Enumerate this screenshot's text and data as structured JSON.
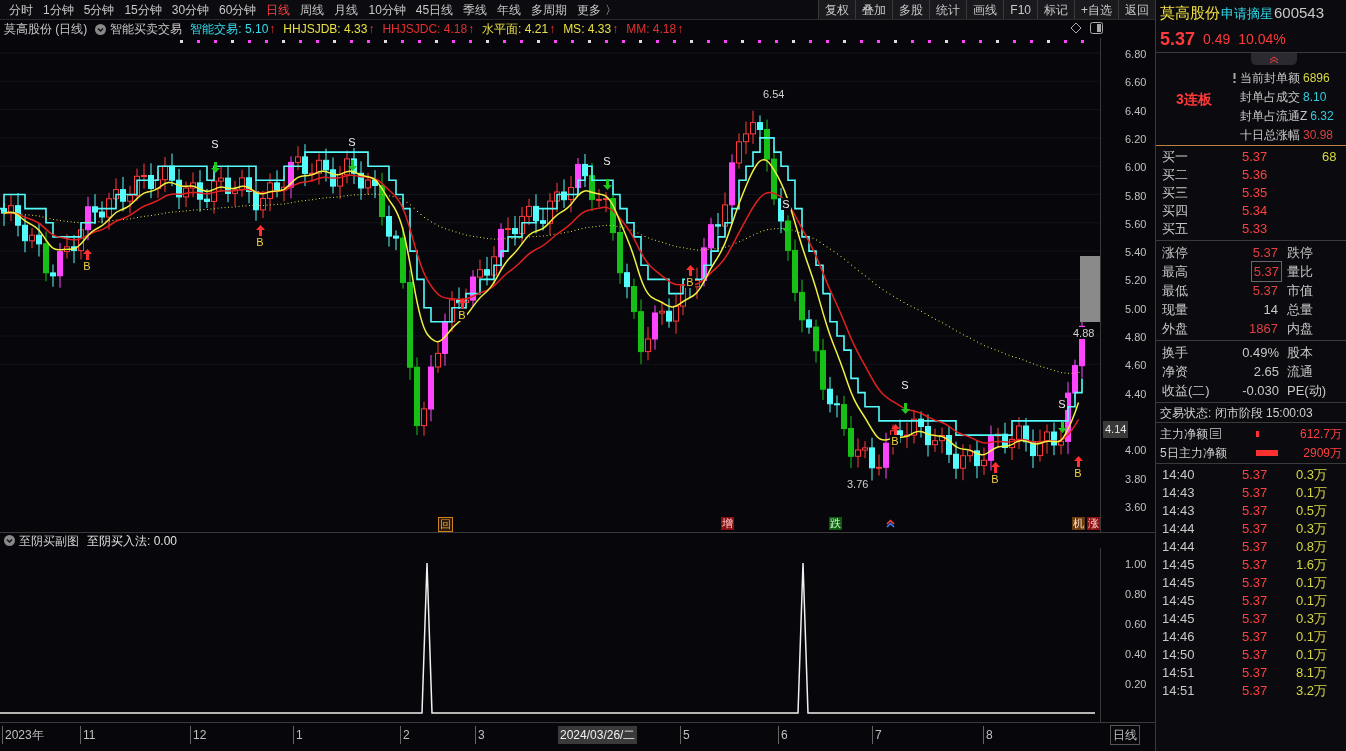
{
  "toolbar": {
    "tabs": [
      {
        "label": "分时",
        "selected": false
      },
      {
        "label": "1分钟",
        "selected": false
      },
      {
        "label": "5分钟",
        "selected": false
      },
      {
        "label": "15分钟",
        "selected": false
      },
      {
        "label": "30分钟",
        "selected": false
      },
      {
        "label": "60分钟",
        "selected": false
      },
      {
        "label": "日线",
        "selected": true
      },
      {
        "label": "周线",
        "selected": false
      },
      {
        "label": "月线",
        "selected": false
      },
      {
        "label": "10分钟",
        "selected": false
      },
      {
        "label": "45日线",
        "selected": false
      },
      {
        "label": "季线",
        "selected": false
      },
      {
        "label": "年线",
        "selected": false
      },
      {
        "label": "多周期",
        "selected": false
      },
      {
        "label": "更多 〉",
        "selected": false
      }
    ],
    "buttons": [
      "复权",
      "叠加",
      "多股",
      "统计",
      "画线",
      "F10",
      "标记",
      "+自选",
      "返回"
    ]
  },
  "legend": {
    "title": "莫高股份 (日线)",
    "indicator": "智能买卖交易",
    "values": [
      {
        "label": "智能交易: 5.10",
        "arrow": "↑",
        "color": "#33ddee"
      },
      {
        "label": "HHJSJDB: 4.33",
        "arrow": "↑",
        "color": "#e8e040"
      },
      {
        "label": "HHJSJDC: 4.18",
        "arrow": "↑",
        "color": "#e03030"
      },
      {
        "label": "水平面: 4.21",
        "arrow": "↑",
        "color": "#e8e040"
      },
      {
        "label": "MS: 4.33",
        "arrow": "↑",
        "color": "#e8e040"
      },
      {
        "label": "MM: 4.18",
        "arrow": "↑",
        "color": "#e03030"
      }
    ]
  },
  "main_chart": {
    "yticks": [
      "6.80",
      "6.60",
      "6.40",
      "6.20",
      "6.00",
      "5.80",
      "5.60",
      "5.40",
      "5.20",
      "5.00",
      "4.80",
      "4.60",
      "4.40",
      "4.00",
      "3.80",
      "3.60"
    ],
    "price_labels": [
      "6.54",
      "3.76",
      "4.88"
    ],
    "current_price": "4.14",
    "signals": [
      {
        "kind": "sell",
        "label": "S"
      },
      {
        "kind": "sell",
        "label": "S"
      },
      {
        "kind": "sell",
        "label": "S"
      },
      {
        "kind": "sell",
        "label": "S"
      },
      {
        "kind": "sell",
        "label": "S"
      },
      {
        "kind": "sell",
        "label": "S"
      },
      {
        "kind": "buy",
        "label": "B"
      },
      {
        "kind": "buy",
        "label": "B"
      },
      {
        "kind": "buy",
        "label": "B"
      },
      {
        "kind": "buy",
        "label": "B"
      },
      {
        "kind": "buy",
        "label": "B"
      },
      {
        "kind": "buy",
        "label": "B"
      },
      {
        "kind": "buy",
        "label": "B"
      }
    ],
    "events": [
      {
        "kind": "return",
        "label": "回"
      },
      {
        "kind": "add",
        "label": "增"
      },
      {
        "kind": "fall",
        "label": "跌"
      },
      {
        "kind": "concept",
        "label": "机"
      },
      {
        "kind": "rise",
        "label": "涨"
      }
    ]
  },
  "sub_chart": {
    "title": "至阴买副图",
    "value": "至阴买入法: 0.00",
    "yticks": [
      "1.00",
      "0.80",
      "0.60",
      "0.40",
      "0.20"
    ]
  },
  "x_axis": {
    "labels": [
      "2023年",
      "11",
      "12",
      "1",
      "2",
      "3",
      "5",
      "6",
      "7",
      "8"
    ],
    "cursor_date": "2024/03/26/二",
    "period": "日线"
  },
  "quote": {
    "name": "莫高股份",
    "tag": "申请摘星",
    "code": "600543",
    "price": "5.37",
    "change": "0.49",
    "percent": "10.04%",
    "streak": "3连板",
    "seal": [
      {
        "label": "当前封单额",
        "value": "6896",
        "color": "#d8d840",
        "has_icon": true
      },
      {
        "label": "封单占成交",
        "value": "8.10",
        "color": "#33ccdd",
        "has_icon": false
      },
      {
        "label": "封单占流通Z",
        "value": "6.32",
        "color": "#33ccdd",
        "has_icon": false
      },
      {
        "label": "十日总涨幅",
        "value": "30.98",
        "color": "#e04040",
        "has_icon": false
      }
    ],
    "bids": [
      {
        "label": "买一",
        "price": "5.37",
        "volume": "68"
      },
      {
        "label": "买二",
        "price": "5.36"
      },
      {
        "label": "买三",
        "price": "5.35"
      },
      {
        "label": "买四",
        "price": "5.34"
      },
      {
        "label": "买五",
        "price": "5.33"
      }
    ],
    "stats": [
      {
        "label": "涨停",
        "value": "5.37",
        "label2": "跌停",
        "color": "#e04040",
        "highlighted": false
      },
      {
        "label": "最高",
        "value": "5.37",
        "label2": "量比",
        "color": "#e04040",
        "highlighted": true
      },
      {
        "label": "最低",
        "value": "5.37",
        "label2": "市值",
        "color": "#e04040",
        "highlighted": false
      },
      {
        "label": "现量",
        "value": "14",
        "label2": "总量",
        "color": "#c8c8c8",
        "highlighted": false
      },
      {
        "label": "外盘",
        "value": "1867",
        "label2": "内盘",
        "color": "#e04040",
        "highlighted": false
      }
    ],
    "fundamentals": [
      {
        "label": "换手",
        "value": "0.49%",
        "label2": "股本"
      },
      {
        "label": "净资",
        "value": "2.65",
        "label2": "流通"
      },
      {
        "label": "收益(二)",
        "value": "-0.030",
        "label2": "PE(动)"
      }
    ],
    "status": "交易状态: 闭市阶段 15:00:03",
    "flows": [
      {
        "label": "主力净额",
        "value": "612.7万",
        "has_icon": true
      },
      {
        "label": "5日主力净额",
        "value": "2909万",
        "has_icon": false
      }
    ],
    "ticks": [
      {
        "time": "14:40",
        "price": "5.37",
        "volume": "0.3万"
      },
      {
        "time": "14:43",
        "price": "5.37",
        "volume": "0.1万"
      },
      {
        "time": "14:43",
        "price": "5.37",
        "volume": "0.5万"
      },
      {
        "time": "14:44",
        "price": "5.37",
        "volume": "0.3万"
      },
      {
        "time": "14:44",
        "price": "5.37",
        "volume": "0.8万"
      },
      {
        "time": "14:45",
        "price": "5.37",
        "volume": "1.6万"
      },
      {
        "time": "14:45",
        "price": "5.37",
        "volume": "0.1万"
      },
      {
        "time": "14:45",
        "price": "5.37",
        "volume": "0.1万"
      },
      {
        "time": "14:45",
        "price": "5.37",
        "volume": "0.3万"
      },
      {
        "time": "14:46",
        "price": "5.37",
        "volume": "0.1万"
      },
      {
        "time": "14:50",
        "price": "5.37",
        "volume": "0.1万"
      },
      {
        "time": "14:51",
        "price": "5.37",
        "volume": "8.1万"
      },
      {
        "time": "14:51",
        "price": "5.37",
        "volume": "3.2万"
      }
    ]
  }
}
